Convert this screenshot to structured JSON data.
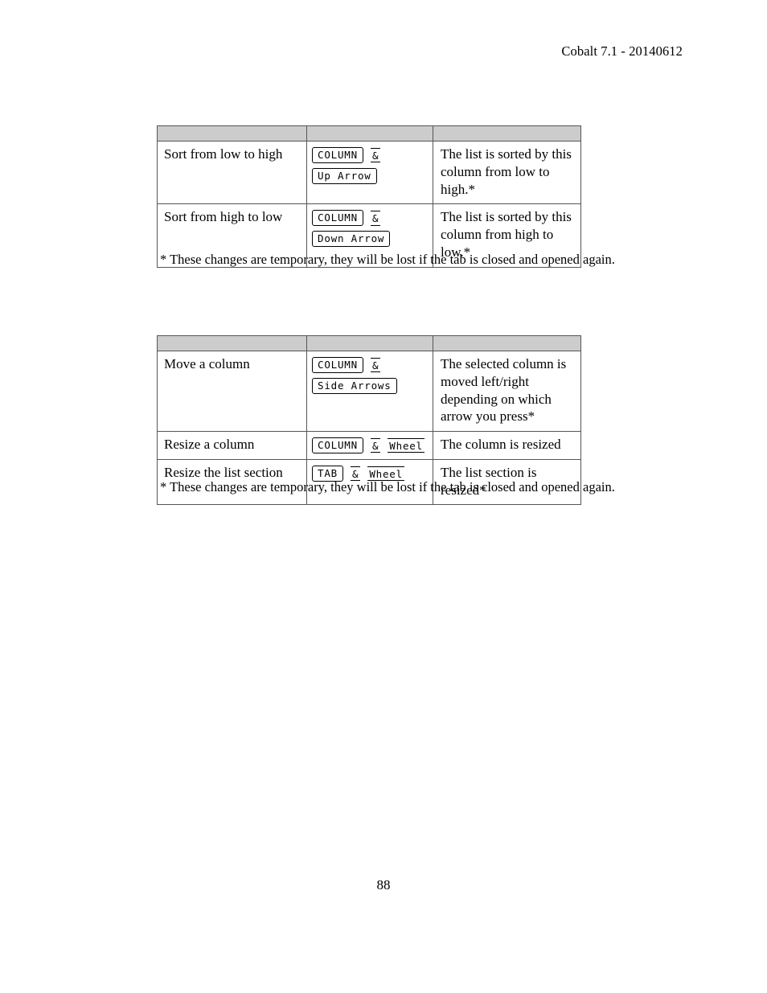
{
  "document": {
    "running_header": "Cobalt 7.1 - 20140612",
    "page_number": "88"
  },
  "colors": {
    "header_row_fill": "#cccccc",
    "table_border": "#555555",
    "keycap_border": "#000000",
    "text": "#000000",
    "page_background": "#ffffff"
  },
  "tables": [
    {
      "id": "sorting-shortcuts",
      "header_cells": [
        "",
        "",
        ""
      ],
      "rows": [
        {
          "action": "Sort from low to high",
          "keys": [
            {
              "parts": [
                {
                  "type": "keycap",
                  "label": "COLUMN"
                },
                {
                  "type": "gap",
                  "size": "sm"
                },
                {
                  "type": "keycap-open",
                  "label": "&"
                }
              ]
            },
            {
              "parts": [
                {
                  "type": "keycap",
                  "label": "Up Arrow"
                }
              ]
            }
          ],
          "result": "The list is sorted by this column from low to high.*"
        },
        {
          "action": "Sort from high to low",
          "keys": [
            {
              "parts": [
                {
                  "type": "keycap",
                  "label": "COLUMN"
                },
                {
                  "type": "gap",
                  "size": "sm"
                },
                {
                  "type": "keycap-open",
                  "label": "&"
                }
              ]
            },
            {
              "parts": [
                {
                  "type": "keycap",
                  "label": "Down Arrow"
                }
              ]
            }
          ],
          "result": "The list is sorted by this column from high to low.*"
        }
      ],
      "footnote": "* These changes are temporary, they will be lost if the tab is closed and opened again."
    },
    {
      "id": "column-layout-shortcuts",
      "header_cells": [
        "",
        "",
        ""
      ],
      "rows": [
        {
          "action": "Move a column",
          "keys": [
            {
              "parts": [
                {
                  "type": "keycap",
                  "label": "COLUMN"
                },
                {
                  "type": "gap",
                  "size": "sm"
                },
                {
                  "type": "keycap-open",
                  "label": "&"
                }
              ]
            },
            {
              "parts": [
                {
                  "type": "keycap",
                  "label": "Side Arrows"
                }
              ]
            }
          ],
          "result": "The selected column is moved left/right depending on which arrow you press*"
        },
        {
          "action": "Resize a column",
          "keys": [
            {
              "parts": [
                {
                  "type": "keycap",
                  "label": "COLUMN"
                },
                {
                  "type": "gap",
                  "size": "sm"
                },
                {
                  "type": "keycap-open",
                  "label": "&"
                },
                {
                  "type": "gap",
                  "size": "sm"
                },
                {
                  "type": "keycap-open",
                  "label": "Wheel"
                }
              ]
            }
          ],
          "result": "The column is resized"
        },
        {
          "action": "Resize the list section",
          "keys": [
            {
              "parts": [
                {
                  "type": "keycap",
                  "label": "TAB"
                },
                {
                  "type": "gap",
                  "size": "sm"
                },
                {
                  "type": "keycap-open",
                  "label": "&"
                },
                {
                  "type": "gap",
                  "size": "sm"
                },
                {
                  "type": "keycap-open",
                  "label": "Wheel"
                }
              ]
            }
          ],
          "result": "The list section is resized*"
        }
      ],
      "footnote": "* These changes are temporary, they will be lost if the tab is closed and opened again."
    }
  ]
}
